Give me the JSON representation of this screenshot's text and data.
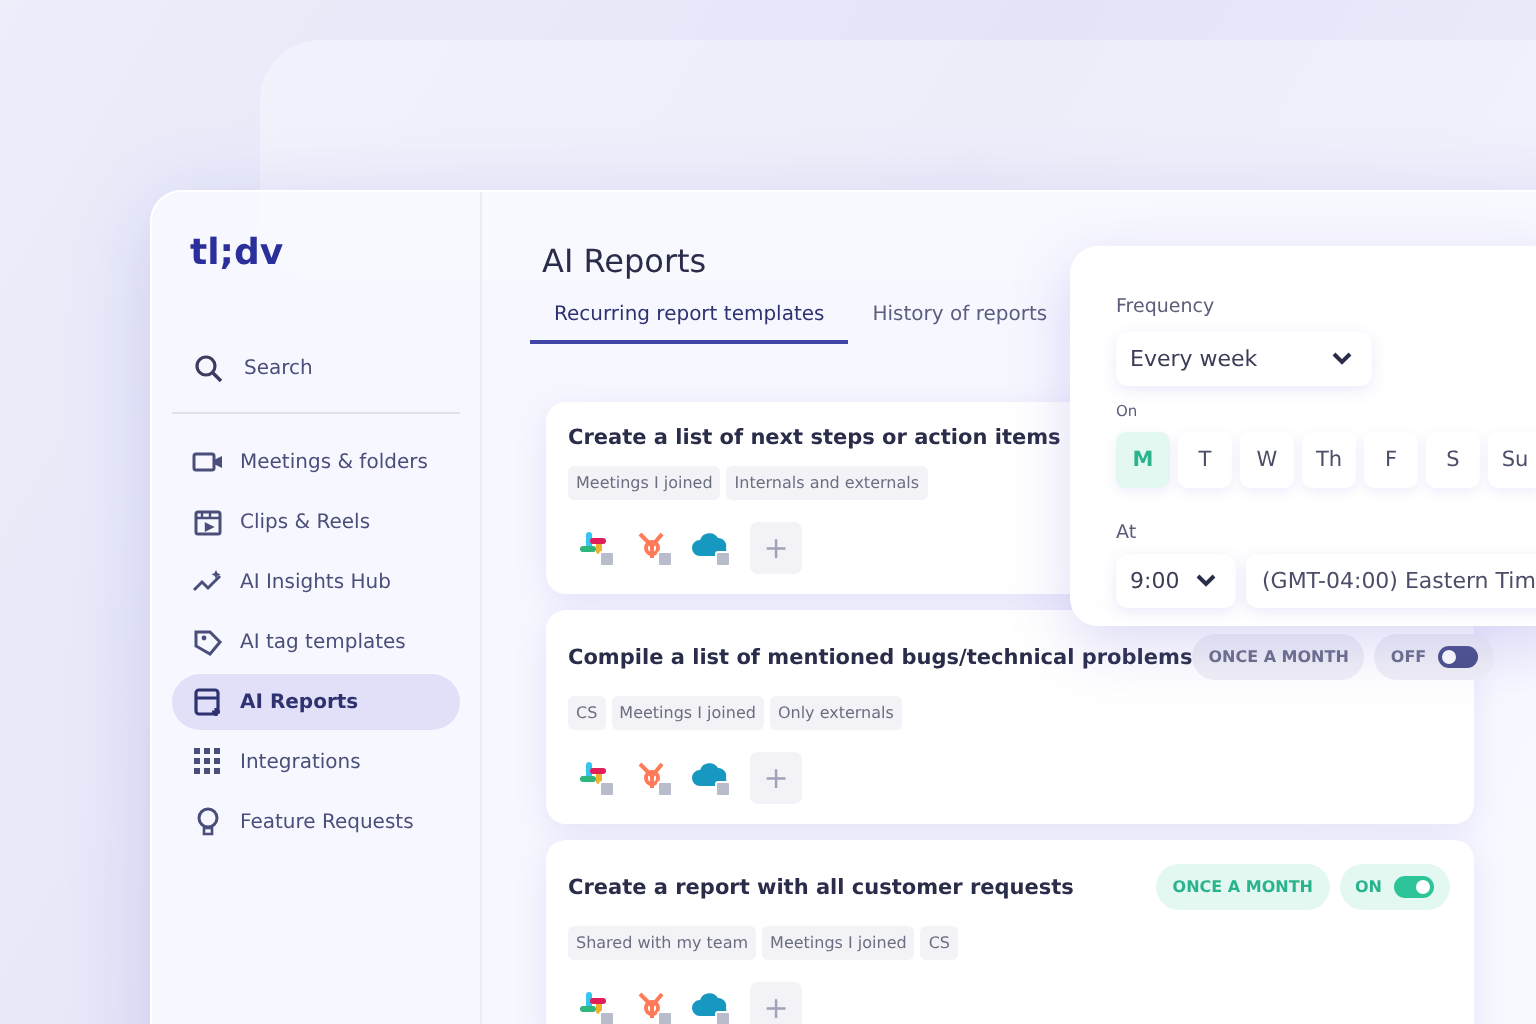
{
  "logo": "tl;dv",
  "search": {
    "label": "Search"
  },
  "sidebar": {
    "items": [
      {
        "label": "Meetings & folders",
        "selected": false
      },
      {
        "label": "Clips & Reels",
        "selected": false
      },
      {
        "label": "AI Insights Hub",
        "selected": false
      },
      {
        "label": "AI tag templates",
        "selected": false
      },
      {
        "label": "AI Reports",
        "selected": true
      },
      {
        "label": "Integrations",
        "selected": false
      },
      {
        "label": "Feature Requests",
        "selected": false
      }
    ]
  },
  "page": {
    "title": "AI Reports"
  },
  "tabs": [
    {
      "label": "Recurring report templates",
      "selected": true
    },
    {
      "label": "History of reports",
      "selected": false
    }
  ],
  "reports": [
    {
      "title": "Create a list of next steps or action items",
      "tags": [
        "Meetings I joined",
        "Internals and externals"
      ],
      "add_button": "+"
    },
    {
      "title": "Compile a list of mentioned bugs/technical problems",
      "frequency": "ONCE A MONTH",
      "toggle_label": "OFF",
      "enabled": false,
      "tags": [
        "CS",
        "Meetings I joined",
        "Only externals"
      ],
      "add_button": "+"
    },
    {
      "title": "Create a report with all customer requests",
      "frequency": "ONCE A MONTH",
      "toggle_label": "ON",
      "enabled": true,
      "tags": [
        "Shared with my team",
        "Meetings I joined",
        "CS"
      ],
      "add_button": "+"
    }
  ],
  "schedule_popup": {
    "frequency_label": "Frequency",
    "frequency_value": "Every week",
    "on_label": "On",
    "days": [
      {
        "label": "M",
        "selected": true
      },
      {
        "label": "T",
        "selected": false
      },
      {
        "label": "W",
        "selected": false
      },
      {
        "label": "Th",
        "selected": false
      },
      {
        "label": "F",
        "selected": false
      },
      {
        "label": "S",
        "selected": false
      },
      {
        "label": "Su",
        "selected": false
      }
    ],
    "at_label": "At",
    "time_value": "9:00",
    "timezone_value": "(GMT-04:00) Eastern Tim"
  }
}
